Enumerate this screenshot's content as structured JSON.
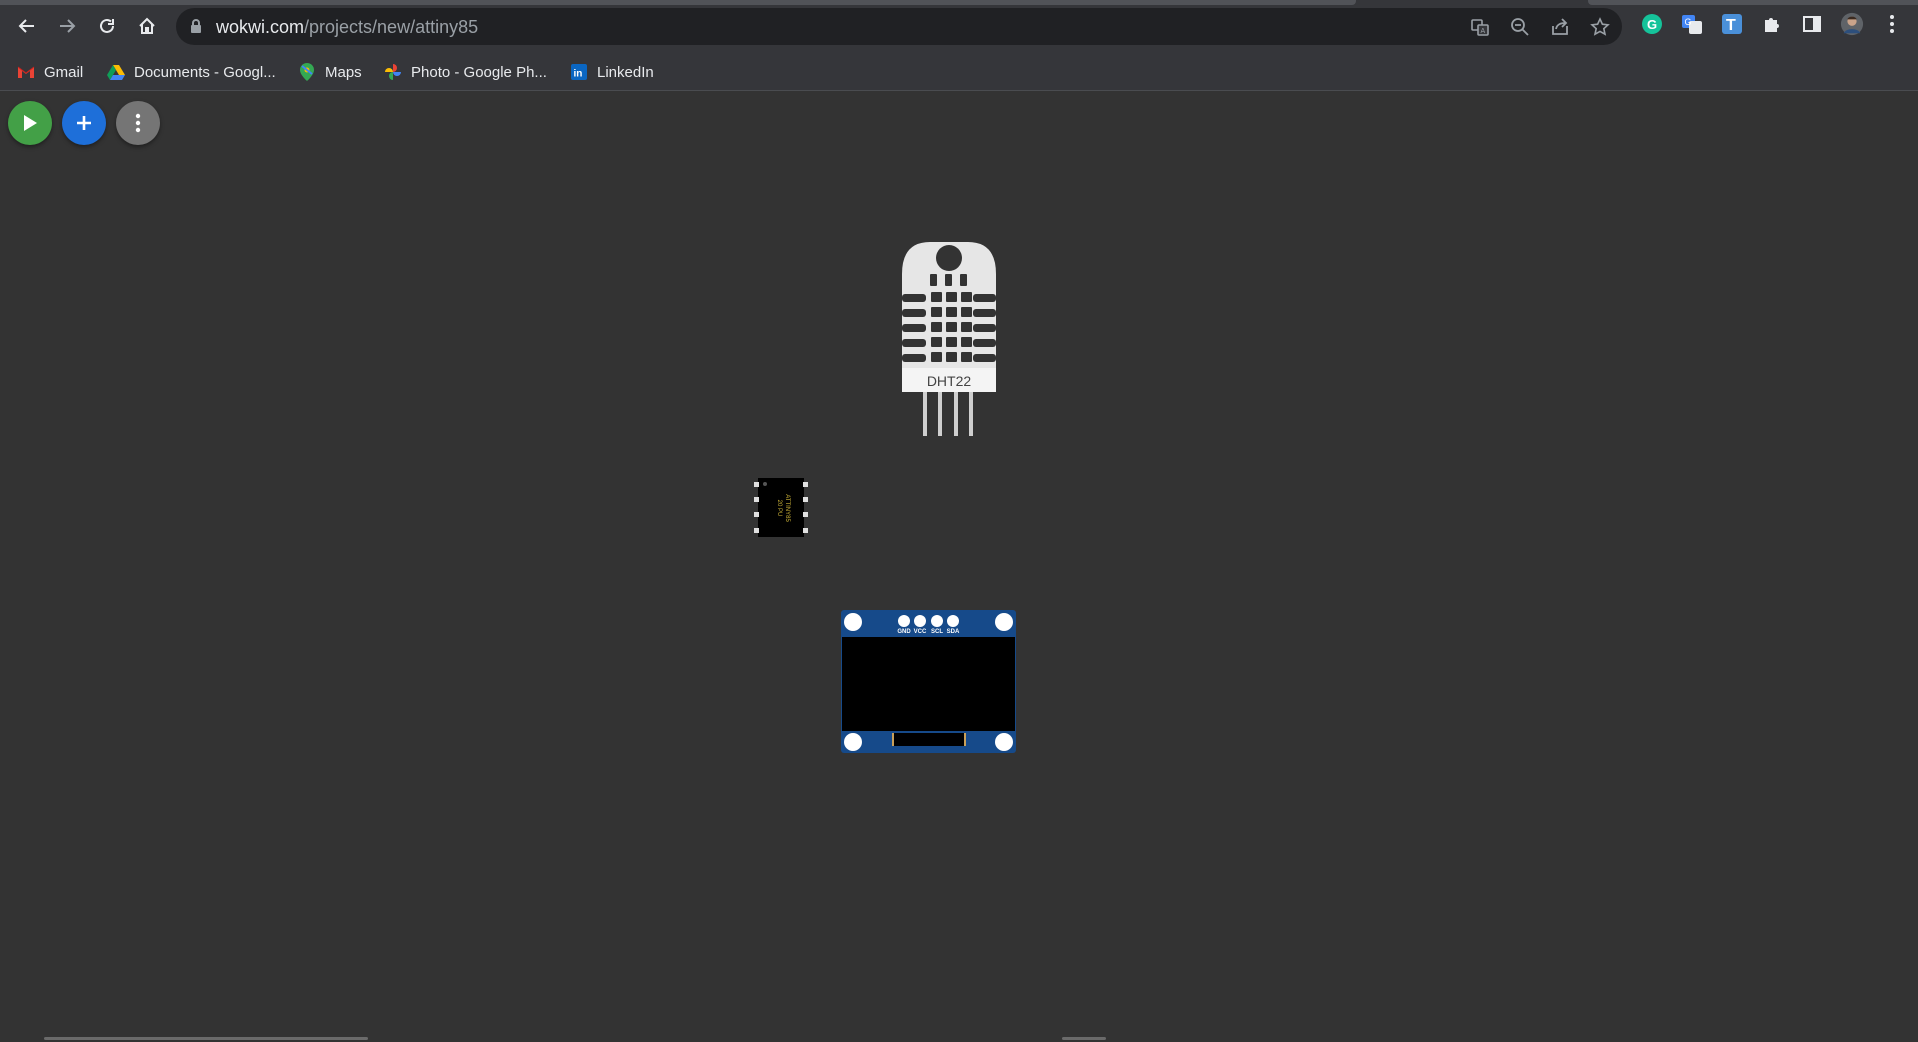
{
  "browser": {
    "url_host": "wokwi.com",
    "url_path": "/projects/new/attiny85",
    "nav": [
      "back-icon",
      "forward-icon",
      "reload-icon",
      "home-icon"
    ],
    "omnibox_icons": [
      "translate-icon",
      "zoom-out-icon",
      "share-icon",
      "star-icon"
    ],
    "extensions": [
      "grammarly-icon",
      "google-translate-icon",
      "t-extension-icon",
      "puzzle-icon",
      "side-panel-icon",
      "profile-avatar",
      "menu-dots-icon"
    ]
  },
  "bookmarks": [
    {
      "label": "Gmail",
      "icon": "gmail-icon"
    },
    {
      "label": "Documents - Googl...",
      "icon": "drive-icon"
    },
    {
      "label": "Maps",
      "icon": "maps-icon"
    },
    {
      "label": "Photo - Google Ph...",
      "icon": "photos-icon"
    },
    {
      "label": "LinkedIn",
      "icon": "linkedin-icon"
    }
  ],
  "toolbar": {
    "play_icon": "play-icon",
    "add_icon": "plus-icon",
    "more_icon": "more-vert-icon",
    "colors": {
      "play": "#43a047",
      "add": "#1e6fd9",
      "more": "#757575"
    }
  },
  "canvas": {
    "background": "#333333",
    "dht22": {
      "label": "DHT22"
    },
    "attiny": {
      "text_line1": "ATTINY85",
      "text_line2": "20 PU"
    },
    "oled": {
      "pins": [
        "GND",
        "VCC",
        "SCL",
        "SDA"
      ]
    }
  }
}
